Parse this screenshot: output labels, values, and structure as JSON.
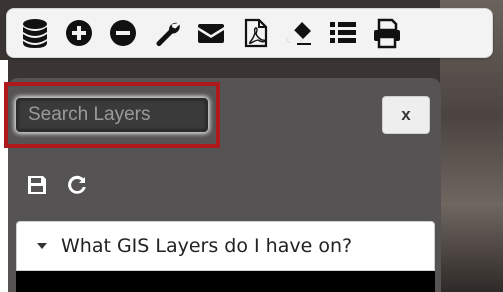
{
  "toolbar": {
    "buttons": [
      {
        "name": "layers-database-icon"
      },
      {
        "name": "zoom-in-plus-icon"
      },
      {
        "name": "zoom-out-minus-icon"
      },
      {
        "name": "wrench-tools-icon"
      },
      {
        "name": "email-envelope-icon"
      },
      {
        "name": "pdf-file-icon"
      },
      {
        "name": "eraser-icon"
      },
      {
        "name": "list-icon"
      },
      {
        "name": "print-icon"
      }
    ]
  },
  "search": {
    "placeholder": "Search Layers",
    "value": ""
  },
  "panel": {
    "close_label": "x",
    "accordion_title": "What GIS Layers do I have on?"
  },
  "colors": {
    "highlight": "#b0191c",
    "panel_bg": "#555353",
    "toolbar_bg": "#f3f3f3"
  }
}
